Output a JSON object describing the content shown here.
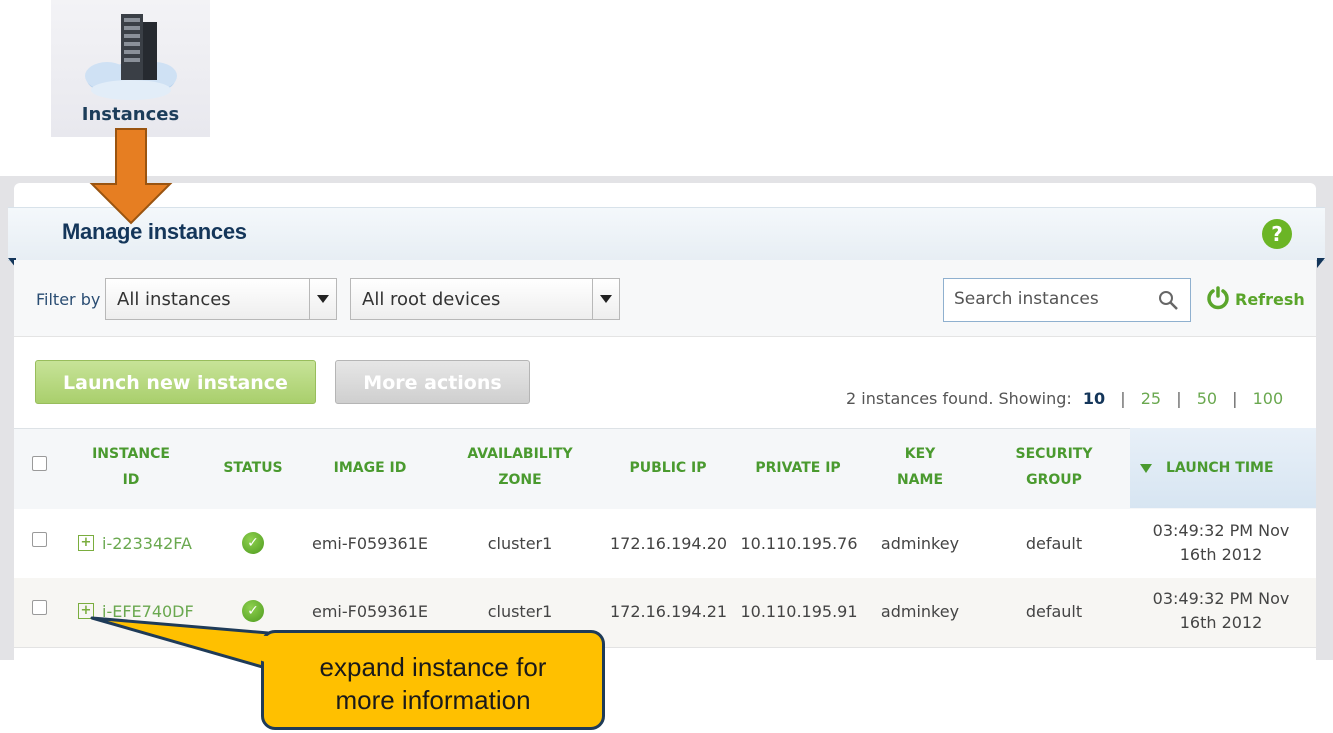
{
  "launcher": {
    "label": "Instances",
    "icon": "server-cloud-icon"
  },
  "header": {
    "title": "Manage instances",
    "help_icon": "question-mark-icon",
    "help_symbol": "?"
  },
  "filters": {
    "label": "Filter by",
    "instances_select": {
      "value": "All instances"
    },
    "root_select": {
      "value": "All root devices"
    },
    "search": {
      "placeholder": "Search instances"
    },
    "refresh_label": "Refresh"
  },
  "actions": {
    "launch_label": "Launch new instance",
    "more_label": "More actions"
  },
  "pagination": {
    "found_text": "2 instances found. Showing:",
    "current": "10",
    "options": [
      "25",
      "50",
      "100"
    ],
    "separator": "|"
  },
  "table": {
    "columns": [
      {
        "line1": "INSTANCE",
        "line2": "ID"
      },
      {
        "line1": "STATUS",
        "line2": ""
      },
      {
        "line1": "IMAGE ID",
        "line2": ""
      },
      {
        "line1": "AVAILABILITY",
        "line2": "ZONE"
      },
      {
        "line1": "PUBLIC IP",
        "line2": ""
      },
      {
        "line1": "PRIVATE IP",
        "line2": ""
      },
      {
        "line1": "KEY",
        "line2": "NAME"
      },
      {
        "line1": "SECURITY",
        "line2": "GROUP"
      },
      {
        "line1": "LAUNCH TIME",
        "line2": "",
        "sort": "descending"
      }
    ],
    "rows": [
      {
        "id": "i-223342FA",
        "status": "running",
        "image": "emi-F059361E",
        "zone": "cluster1",
        "public_ip": "172.16.194.20",
        "private_ip": "10.110.195.76",
        "key": "adminkey",
        "group": "default",
        "launch_line1": "03:49:32 PM Nov",
        "launch_line2": "16th 2012"
      },
      {
        "id": "i-EFE740DF",
        "status": "running",
        "image": "emi-F059361E",
        "zone": "cluster1",
        "public_ip": "172.16.194.21",
        "private_ip": "10.110.195.91",
        "key": "adminkey",
        "group": "default",
        "launch_line1": "03:49:32 PM Nov",
        "launch_line2": "16th 2012"
      }
    ]
  },
  "callout": {
    "line1": "expand instance for",
    "line2": "more information"
  },
  "colors": {
    "accent_green": "#6aa84f",
    "title_navy": "#14365a",
    "callout_fill": "#ffc000",
    "arrow_orange": "#e67e22"
  }
}
